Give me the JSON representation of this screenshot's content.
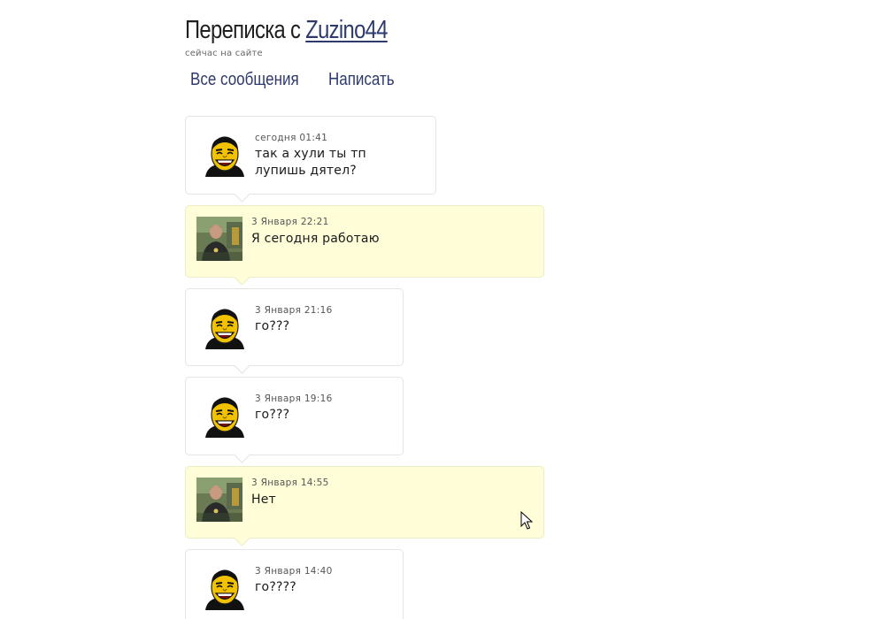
{
  "header": {
    "title_prefix": "Переписка с",
    "username": "Zuzino44",
    "status": "сейчас на сайте"
  },
  "nav": {
    "all_messages": "Все сообщения",
    "write": "Написать"
  },
  "messages": [
    {
      "time": "сегодня 01:41",
      "text": "так а хули ты тп лупишь дятел?"
    },
    {
      "time": "3 Января 22:21",
      "text": "Я сегодня работаю"
    },
    {
      "time": "3 Января 21:16",
      "text": "го???"
    },
    {
      "time": "3 Января 19:16",
      "text": "го???"
    },
    {
      "time": "3 Января 14:55",
      "text": "Нет"
    },
    {
      "time": "3 Января 14:40",
      "text": "го????"
    }
  ],
  "icons": {
    "their_avatar": "cartoon-laughing-face-icon",
    "my_avatar": "user-photo-avatar",
    "cursor": "mouse-pointer-icon"
  },
  "colors": {
    "link": "#2e3a6e",
    "own_message_bg": "#fffed9",
    "message_border": "#e4e4e4"
  }
}
